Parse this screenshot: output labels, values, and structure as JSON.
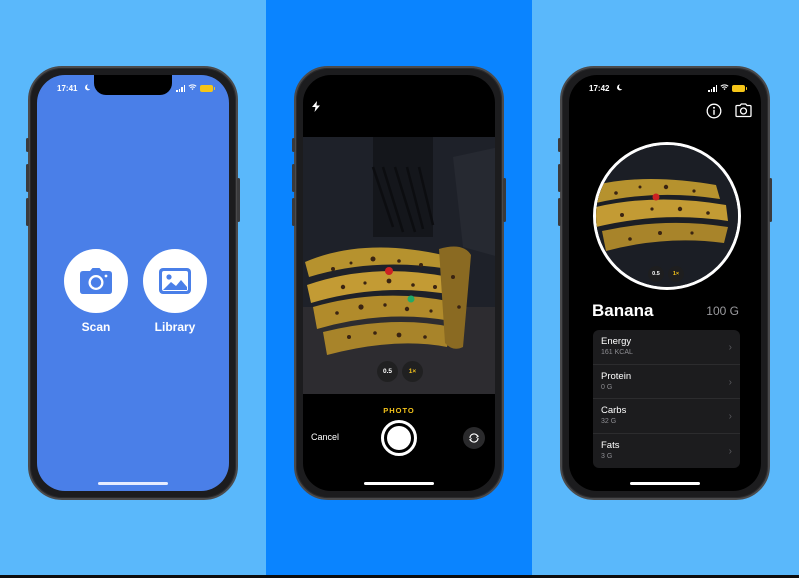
{
  "colors": {
    "left_bg": "#5ab8fb",
    "mid_bg": "#0a84ff",
    "right_bg": "#5ab8fb",
    "home_screen_bg": "#4a7fe8",
    "camera_accent": "#f2c21b"
  },
  "phone1": {
    "time": "17:41",
    "scan": {
      "label": "Scan",
      "icon": "camera-icon"
    },
    "library": {
      "label": "Library",
      "icon": "photo-icon"
    }
  },
  "phone2": {
    "flash_icon": "flash-icon",
    "zoom_options": [
      "0.5",
      "1×"
    ],
    "mode_label": "PHOTO",
    "cancel_label": "Cancel",
    "flip_icon": "camera-flip-icon"
  },
  "phone3": {
    "time": "17:42",
    "info_icon": "info-icon",
    "camera_icon": "camera-icon",
    "zoom_options": [
      "0.5",
      "1×"
    ],
    "food": {
      "name": "Banana",
      "weight": "100 G"
    },
    "nutrients": [
      {
        "name": "Energy",
        "value": "161 KCAL"
      },
      {
        "name": "Protein",
        "value": "0 G"
      },
      {
        "name": "Carbs",
        "value": "32 G"
      },
      {
        "name": "Fats",
        "value": "3 G"
      }
    ]
  }
}
